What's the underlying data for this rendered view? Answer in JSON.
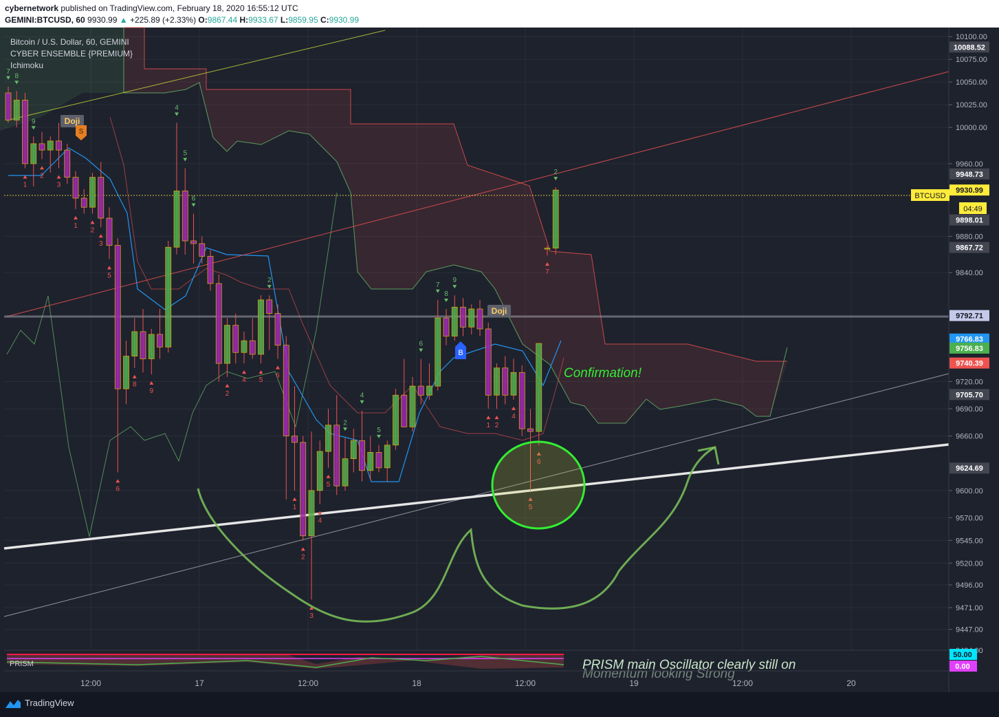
{
  "header": {
    "author": "cybernetwork",
    "published": "published on TradingView.com, February 18, 2020 16:55:12 UTC",
    "symbol": "GEMINI:BTCUSD, 60",
    "last": "9930.99",
    "change": "+225.89 (+2.33%)",
    "o_label": "O:",
    "o": "9867.44",
    "h_label": "H:",
    "h": "9933.67",
    "l_label": "L:",
    "l": "9859.95",
    "c_label": "C:",
    "c": "9930.99"
  },
  "legend": {
    "title": "Bitcoin / U.S. Dollar, 60, GEMINI",
    "ind1": "CYBER ENSEMBLE {PREMIUM}",
    "ind2": "Ichimoku"
  },
  "annotations": {
    "confirmation": "Confirmation!",
    "oscillator_note_1": "PRISM main Oscillator clearly still on",
    "oscillator_note_2": "Momentum looking Strong",
    "oscillator_label": "PRISM",
    "doji": "Doji",
    "buy_marker": "B",
    "sell_marker": "S",
    "price_tag_label": "BTCUSD",
    "countdown": "04:49"
  },
  "footer": {
    "brand": "TradingView"
  },
  "colors": {
    "background": "#1e222d",
    "bull": "#4caf50",
    "bear": "#9c27b0",
    "cloud_red": "#ef5350",
    "cloud_green": "#66bb6a",
    "tenkan": "#2196f3",
    "support_line": "#e6e6e6",
    "annotation_green": "#7cc35a"
  },
  "chart_data": {
    "type": "candlestick",
    "symbol": "GEMINI:BTCUSD",
    "interval": "60",
    "ylim": [
      9424,
      10110
    ],
    "y_ticks": [
      10100,
      10075,
      10050,
      10025,
      10000,
      9960,
      9880,
      9840,
      9720,
      9690,
      9660,
      9600,
      9570,
      9545,
      9520,
      9496,
      9471,
      9447,
      9424
    ],
    "x_tick_labels": [
      "12:00",
      "17",
      "12:00",
      "18",
      "12:00",
      "19",
      "12:00",
      "20"
    ],
    "price_labels": [
      {
        "value": 10088.52,
        "text": "10088.52",
        "bg": "#434651",
        "fg": "#ffffff"
      },
      {
        "value": 9948.73,
        "text": "9948.73",
        "bg": "#434651",
        "fg": "#ffffff"
      },
      {
        "value": 9930.99,
        "text": "9930.99",
        "bg": "#ffeb3b",
        "fg": "#131722"
      },
      {
        "value": 9898.01,
        "text": "9898.01",
        "bg": "#434651",
        "fg": "#ffffff"
      },
      {
        "value": 9867.72,
        "text": "9867.72",
        "bg": "#434651",
        "fg": "#ffffff"
      },
      {
        "value": 9792.71,
        "text": "9792.71",
        "bg": "#c5cae9",
        "fg": "#131722"
      },
      {
        "value": 9766.83,
        "text": "9766.83",
        "bg": "#2196f3",
        "fg": "#ffffff"
      },
      {
        "value": 9756.83,
        "text": "9756.83",
        "bg": "#4caf50",
        "fg": "#ffffff"
      },
      {
        "value": 9740.39,
        "text": "9740.39",
        "bg": "#ef5350",
        "fg": "#ffffff"
      },
      {
        "value": 9705.7,
        "text": "9705.70",
        "bg": "#434651",
        "fg": "#ffffff"
      },
      {
        "value": 9624.69,
        "text": "9624.69",
        "bg": "#434651",
        "fg": "#ffffff"
      }
    ],
    "osc_labels": [
      {
        "text": "50.00",
        "bg": "#00e5ff",
        "fg": "#131722"
      },
      {
        "text": "0.00",
        "bg": "#e040fb",
        "fg": "#ffffff"
      }
    ],
    "candles": [
      {
        "o": 10038,
        "h": 10045,
        "l": 10005,
        "c": 10008
      },
      {
        "o": 10008,
        "h": 10040,
        "l": 10000,
        "c": 10030
      },
      {
        "o": 10030,
        "h": 10038,
        "l": 9955,
        "c": 9960
      },
      {
        "o": 9960,
        "h": 9990,
        "l": 9935,
        "c": 9982
      },
      {
        "o": 9982,
        "h": 9995,
        "l": 9965,
        "c": 9975
      },
      {
        "o": 9975,
        "h": 9990,
        "l": 9950,
        "c": 9985
      },
      {
        "o": 9985,
        "h": 10005,
        "l": 9955,
        "c": 9975
      },
      {
        "o": 9975,
        "h": 9982,
        "l": 9938,
        "c": 9945
      },
      {
        "o": 9945,
        "h": 9952,
        "l": 9910,
        "c": 9922
      },
      {
        "o": 9922,
        "h": 9932,
        "l": 9905,
        "c": 9912
      },
      {
        "o": 9912,
        "h": 9950,
        "l": 9905,
        "c": 9945
      },
      {
        "o": 9945,
        "h": 9962,
        "l": 9890,
        "c": 9900
      },
      {
        "o": 9900,
        "h": 9912,
        "l": 9855,
        "c": 9870
      },
      {
        "o": 9870,
        "h": 9878,
        "l": 9620,
        "c": 9712
      },
      {
        "o": 9712,
        "h": 9765,
        "l": 9695,
        "c": 9748
      },
      {
        "o": 9748,
        "h": 9790,
        "l": 9735,
        "c": 9775
      },
      {
        "o": 9775,
        "h": 9800,
        "l": 9730,
        "c": 9745
      },
      {
        "o": 9745,
        "h": 9778,
        "l": 9728,
        "c": 9772
      },
      {
        "o": 9772,
        "h": 9800,
        "l": 9745,
        "c": 9758
      },
      {
        "o": 9758,
        "h": 9875,
        "l": 9752,
        "c": 9868
      },
      {
        "o": 9868,
        "h": 10005,
        "l": 9860,
        "c": 9930
      },
      {
        "o": 9930,
        "h": 9955,
        "l": 9860,
        "c": 9875
      },
      {
        "o": 9875,
        "h": 9905,
        "l": 9850,
        "c": 9872
      },
      {
        "o": 9872,
        "h": 9880,
        "l": 9850,
        "c": 9858
      },
      {
        "o": 9858,
        "h": 9865,
        "l": 9820,
        "c": 9828
      },
      {
        "o": 9828,
        "h": 9838,
        "l": 9720,
        "c": 9740
      },
      {
        "o": 9740,
        "h": 9790,
        "l": 9725,
        "c": 9782
      },
      {
        "o": 9782,
        "h": 9795,
        "l": 9740,
        "c": 9752
      },
      {
        "o": 9752,
        "h": 9775,
        "l": 9740,
        "c": 9765
      },
      {
        "o": 9765,
        "h": 9790,
        "l": 9745,
        "c": 9750
      },
      {
        "o": 9750,
        "h": 9815,
        "l": 9740,
        "c": 9810
      },
      {
        "o": 9810,
        "h": 9815,
        "l": 9755,
        "c": 9795
      },
      {
        "o": 9795,
        "h": 9805,
        "l": 9745,
        "c": 9760
      },
      {
        "o": 9760,
        "h": 9770,
        "l": 9590,
        "c": 9660
      },
      {
        "o": 9660,
        "h": 9715,
        "l": 9600,
        "c": 9653
      },
      {
        "o": 9653,
        "h": 9660,
        "l": 9545,
        "c": 9550
      },
      {
        "o": 9550,
        "h": 9665,
        "l": 9480,
        "c": 9600
      },
      {
        "o": 9600,
        "h": 9655,
        "l": 9585,
        "c": 9643
      },
      {
        "o": 9643,
        "h": 9690,
        "l": 9625,
        "c": 9672
      },
      {
        "o": 9672,
        "h": 9705,
        "l": 9595,
        "c": 9605
      },
      {
        "o": 9605,
        "h": 9658,
        "l": 9600,
        "c": 9635
      },
      {
        "o": 9635,
        "h": 9668,
        "l": 9620,
        "c": 9655
      },
      {
        "o": 9655,
        "h": 9688,
        "l": 9610,
        "c": 9622
      },
      {
        "o": 9622,
        "h": 9660,
        "l": 9612,
        "c": 9642
      },
      {
        "o": 9642,
        "h": 9650,
        "l": 9620,
        "c": 9625
      },
      {
        "o": 9625,
        "h": 9655,
        "l": 9610,
        "c": 9650
      },
      {
        "o": 9650,
        "h": 9712,
        "l": 9645,
        "c": 9705
      },
      {
        "o": 9705,
        "h": 9745,
        "l": 9700,
        "c": 9670
      },
      {
        "o": 9670,
        "h": 9725,
        "l": 9665,
        "c": 9715
      },
      {
        "o": 9715,
        "h": 9745,
        "l": 9695,
        "c": 9705
      },
      {
        "o": 9705,
        "h": 9740,
        "l": 9700,
        "c": 9715
      },
      {
        "o": 9715,
        "h": 9810,
        "l": 9710,
        "c": 9790
      },
      {
        "o": 9790,
        "h": 9800,
        "l": 9760,
        "c": 9770
      },
      {
        "o": 9770,
        "h": 9815,
        "l": 9765,
        "c": 9802
      },
      {
        "o": 9802,
        "h": 9812,
        "l": 9770,
        "c": 9780
      },
      {
        "o": 9780,
        "h": 9805,
        "l": 9772,
        "c": 9800
      },
      {
        "o": 9800,
        "h": 9810,
        "l": 9770,
        "c": 9778
      },
      {
        "o": 9778,
        "h": 9785,
        "l": 9690,
        "c": 9705
      },
      {
        "o": 9705,
        "h": 9740,
        "l": 9690,
        "c": 9735
      },
      {
        "o": 9735,
        "h": 9748,
        "l": 9695,
        "c": 9705
      },
      {
        "o": 9705,
        "h": 9745,
        "l": 9700,
        "c": 9730
      },
      {
        "o": 9730,
        "h": 9738,
        "l": 9660,
        "c": 9668
      },
      {
        "o": 9668,
        "h": 9690,
        "l": 9600,
        "c": 9665
      },
      {
        "o": 9665,
        "h": 9720,
        "l": 9650,
        "c": 9762
      },
      {
        "o": 9867,
        "h": 9870,
        "l": 9859,
        "c": 9867
      },
      {
        "o": 9867,
        "h": 9934,
        "l": 9860,
        "c": 9931
      }
    ]
  }
}
